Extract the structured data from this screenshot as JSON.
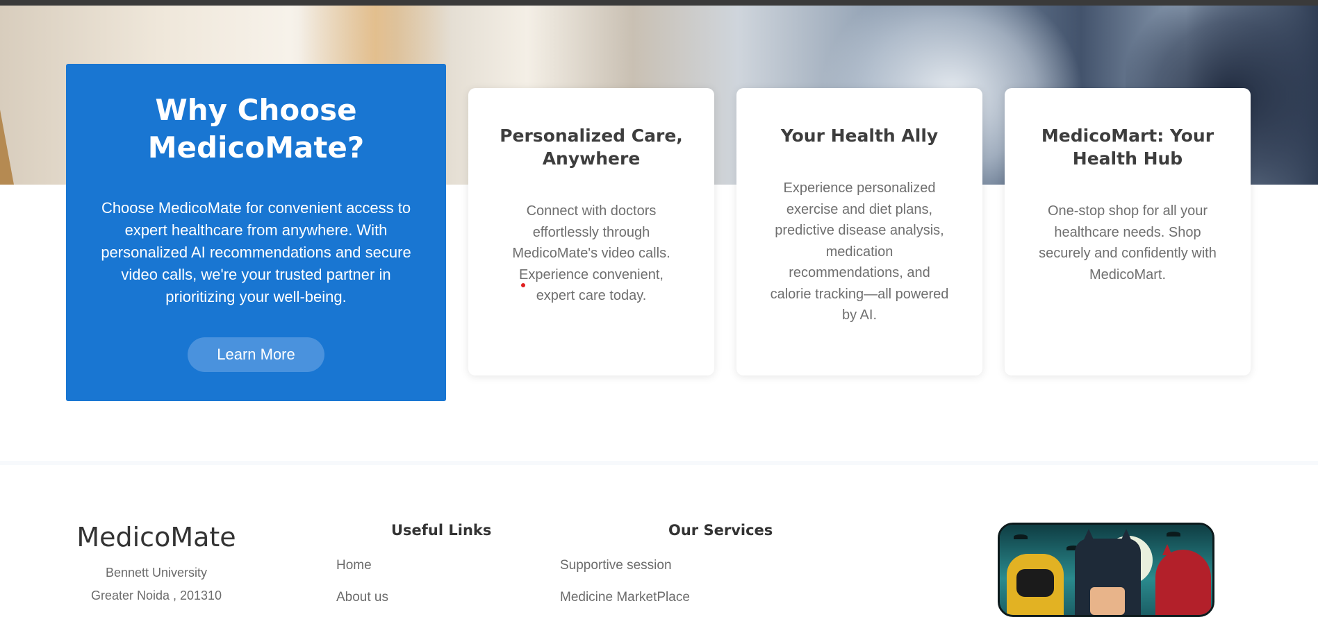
{
  "why": {
    "title": "Why Choose MedicoMate?",
    "body": "Choose MedicoMate for convenient access to expert healthcare from anywhere. With personalized AI recommendations and secure video calls, we're your trusted partner in prioritizing your well-being.",
    "button": "Learn More"
  },
  "features": [
    {
      "title": "Personalized Care, Anywhere",
      "body": "Connect with doctors effortlessly through MedicoMate's video calls. Experience convenient, expert care today."
    },
    {
      "title": "Your Health Ally",
      "body": "Experience personalized exercise and diet plans, predictive disease analysis, medication recommendations, and calorie tracking—all powered by AI."
    },
    {
      "title": "MedicoMart: Your Health Hub",
      "body": "One-stop shop for all your healthcare needs. Shop securely and confidently with MedicoMart."
    }
  ],
  "footer": {
    "brand": "MedicoMate",
    "address_line1": "Bennett University",
    "address_line2": "Greater Noida , 201310",
    "useful_links_title": "Useful Links",
    "useful_links": [
      "Home",
      "About us"
    ],
    "services_title": "Our Services",
    "services": [
      "Supportive session",
      "Medicine MarketPlace"
    ]
  }
}
